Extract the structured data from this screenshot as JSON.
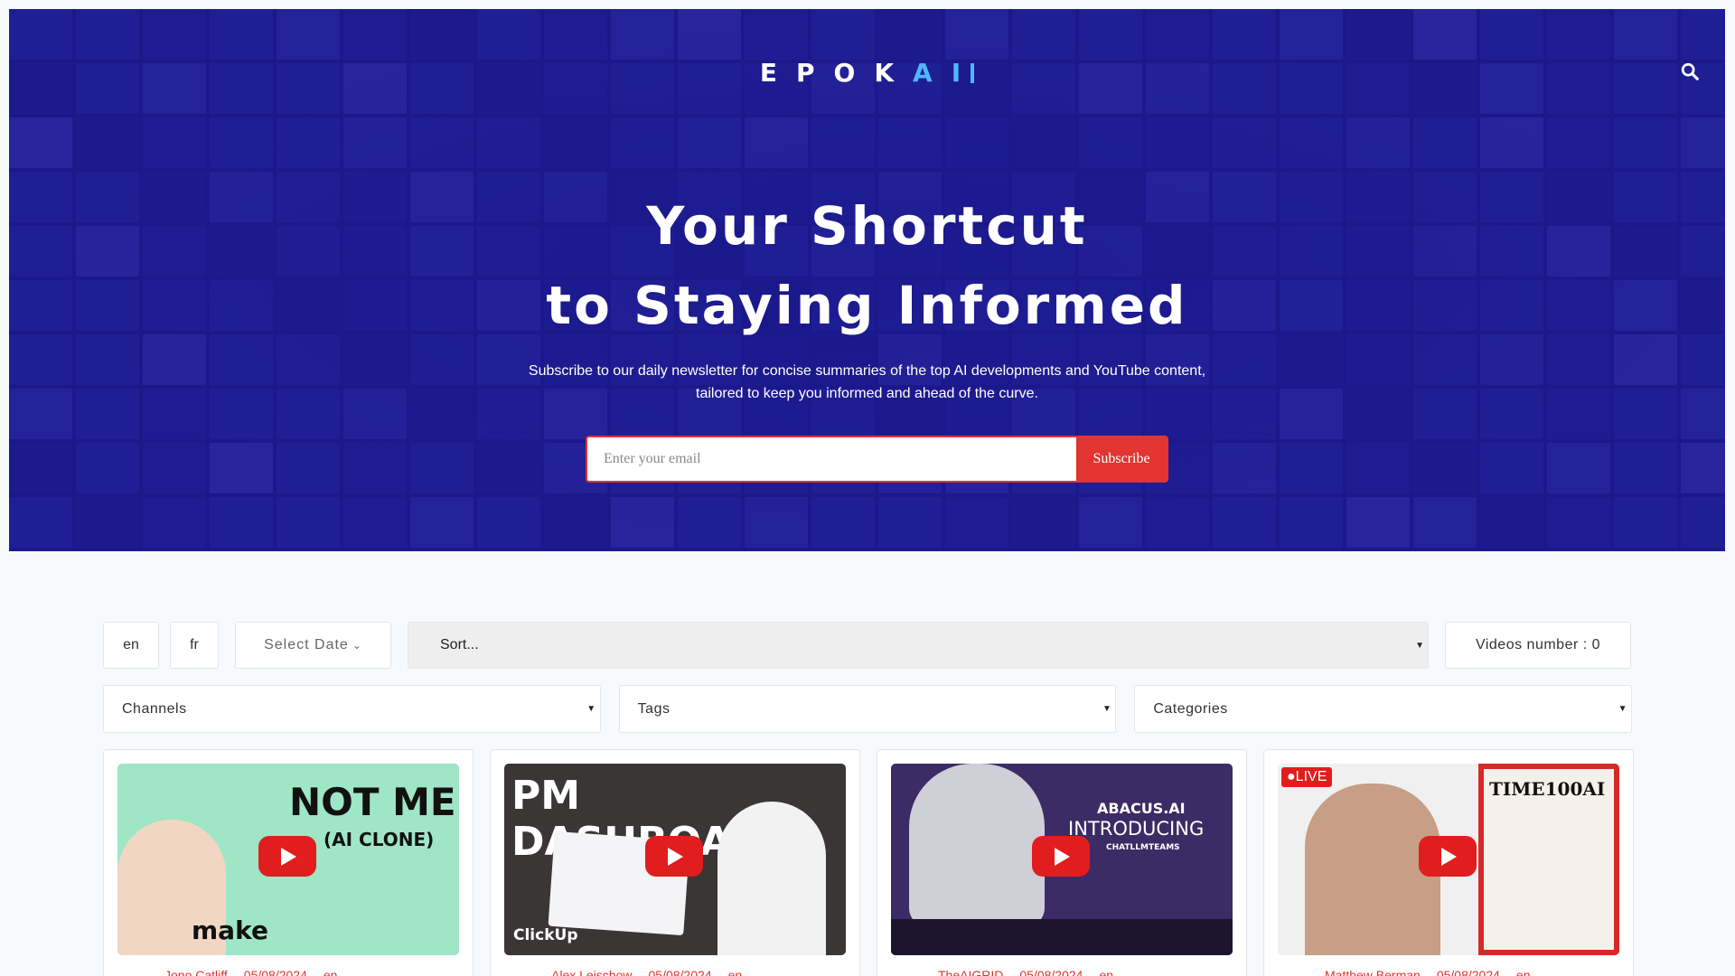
{
  "brand": {
    "logo_text_left": "EPOK",
    "logo_text_right": "AI",
    "accent": "#4fb6ff",
    "hero_bg": "#1c1a8a",
    "cta_color": "#e23430"
  },
  "hero": {
    "headline_line1": "Your Shortcut",
    "headline_line2": "to Staying Informed",
    "subtext_line1": "Subscribe to our daily newsletter for concise summaries of the top AI developments and YouTube content,",
    "subtext_line2": "tailored to keep you informed and ahead of the curve.",
    "email_placeholder": "Enter your email",
    "subscribe_label": "Subscribe",
    "search_icon": "search-icon"
  },
  "filters": {
    "lang_en": "en",
    "lang_fr": "fr",
    "date_label": "Select Date",
    "sort_label": "Sort...",
    "videos_number_label": "Videos number : 0",
    "channels_label": "Channels",
    "tags_label": "Tags",
    "categories_label": "Categories"
  },
  "cards": [
    {
      "title_overlay": "NOT ME",
      "title_sub": "(AI CLONE)",
      "brand_text": "make",
      "channel": "Jono Catliff",
      "date": "05/08/2024",
      "lang": "en"
    },
    {
      "title_overlay": "PM DASHBOARD",
      "brand_text": "ClickUp",
      "channel": "Alex Leischow",
      "date": "05/08/2024",
      "lang": "en"
    },
    {
      "title_overlay": "INTRODUCING",
      "brand_text": "ABACUS.AI",
      "sub_text": "CHATLLMTEAMS",
      "channel": "TheAIGRID",
      "date": "05/08/2024",
      "lang": "en"
    },
    {
      "title_overlay": "TIME100AI",
      "badge": "LIVE",
      "channel": "Matthew Berman",
      "date": "05/08/2024",
      "lang": "en"
    }
  ]
}
